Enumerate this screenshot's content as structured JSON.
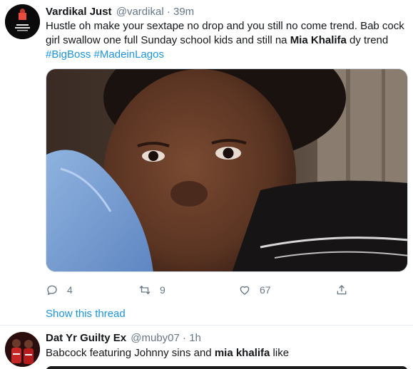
{
  "tweet1": {
    "display_name": "Vardikal Just",
    "handle": "@vardikal",
    "separator": "·",
    "time": "39m",
    "text_part1": "Hustle oh make your sextape no drop and you still no come trend. Bab cock girl swallow one full Sunday school kids and still na ",
    "text_bold": "Mia Khalifa",
    "text_part2": " dy trend",
    "hashtag1": "#BigBoss",
    "hashtag2": "#MadeinLagos",
    "replies": "4",
    "retweets": "9",
    "likes": "67",
    "show_thread": "Show this thread"
  },
  "tweet2": {
    "display_name": "Dat Yr Guilty Ex",
    "handle": "@muby07",
    "separator": "·",
    "time": "1h",
    "text_part1": "Babcock featuring Johnny sins and ",
    "text_bold": "mia khalifa",
    "text_part2": " like"
  },
  "colors": {
    "link": "#1b95e0",
    "muted": "#657786",
    "text": "#14171a",
    "divider": "#e6ecf0"
  },
  "icons": {
    "reply": "reply-icon",
    "retweet": "retweet-icon",
    "like": "heart-icon",
    "share": "share-icon"
  }
}
